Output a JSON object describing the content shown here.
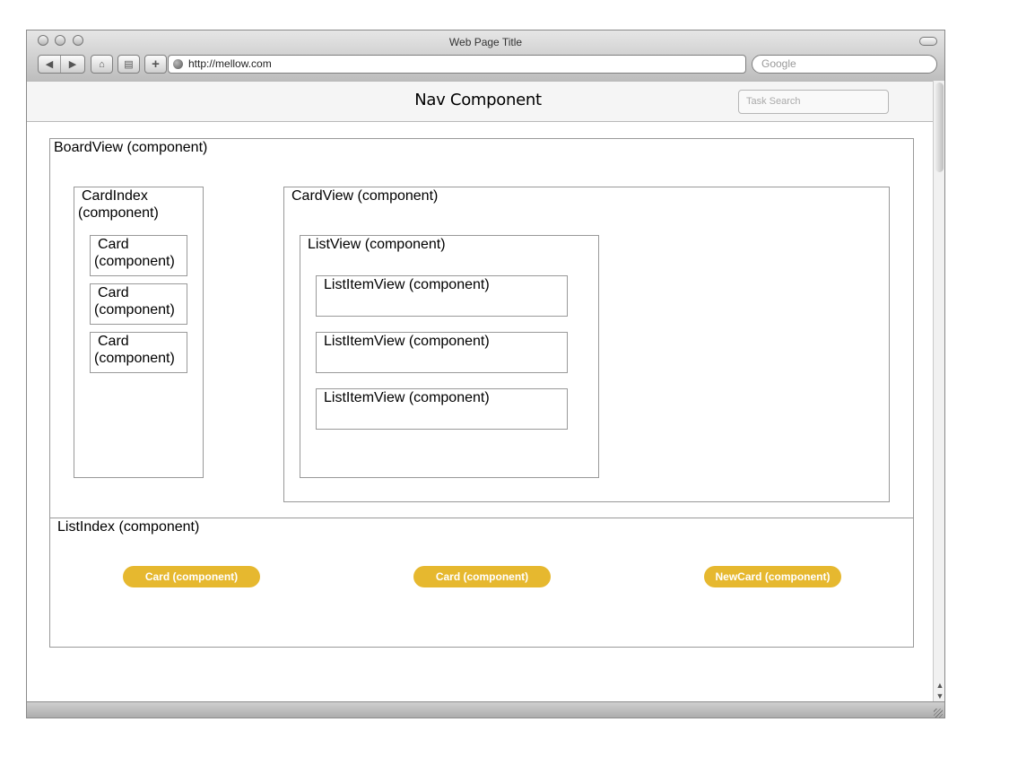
{
  "window": {
    "title": "Web Page Title",
    "url": "http://mellow.com",
    "search_placeholder": "Google"
  },
  "nav": {
    "title": "Nav Component",
    "search_placeholder": "Task Search"
  },
  "board": {
    "label": "BoardView (component)",
    "card_index": {
      "label_line1": "CardIndex",
      "label_line2": "(component)",
      "cards": [
        {
          "line1": "Card",
          "line2": "(component)"
        },
        {
          "line1": "Card",
          "line2": "(component)"
        },
        {
          "line1": "Card",
          "line2": "(component)"
        }
      ]
    },
    "card_view": {
      "label": "CardView (component)",
      "list_view": {
        "label": "ListView (component)",
        "items": [
          "ListItemView (component)",
          "ListItemView (component)",
          "ListItemView (component)"
        ]
      }
    }
  },
  "list_index": {
    "label": "ListIndex (component)",
    "buttons": [
      "Card (component)",
      "Card (component)",
      "NewCard (component)"
    ],
    "button_color": "#e6b82f"
  }
}
